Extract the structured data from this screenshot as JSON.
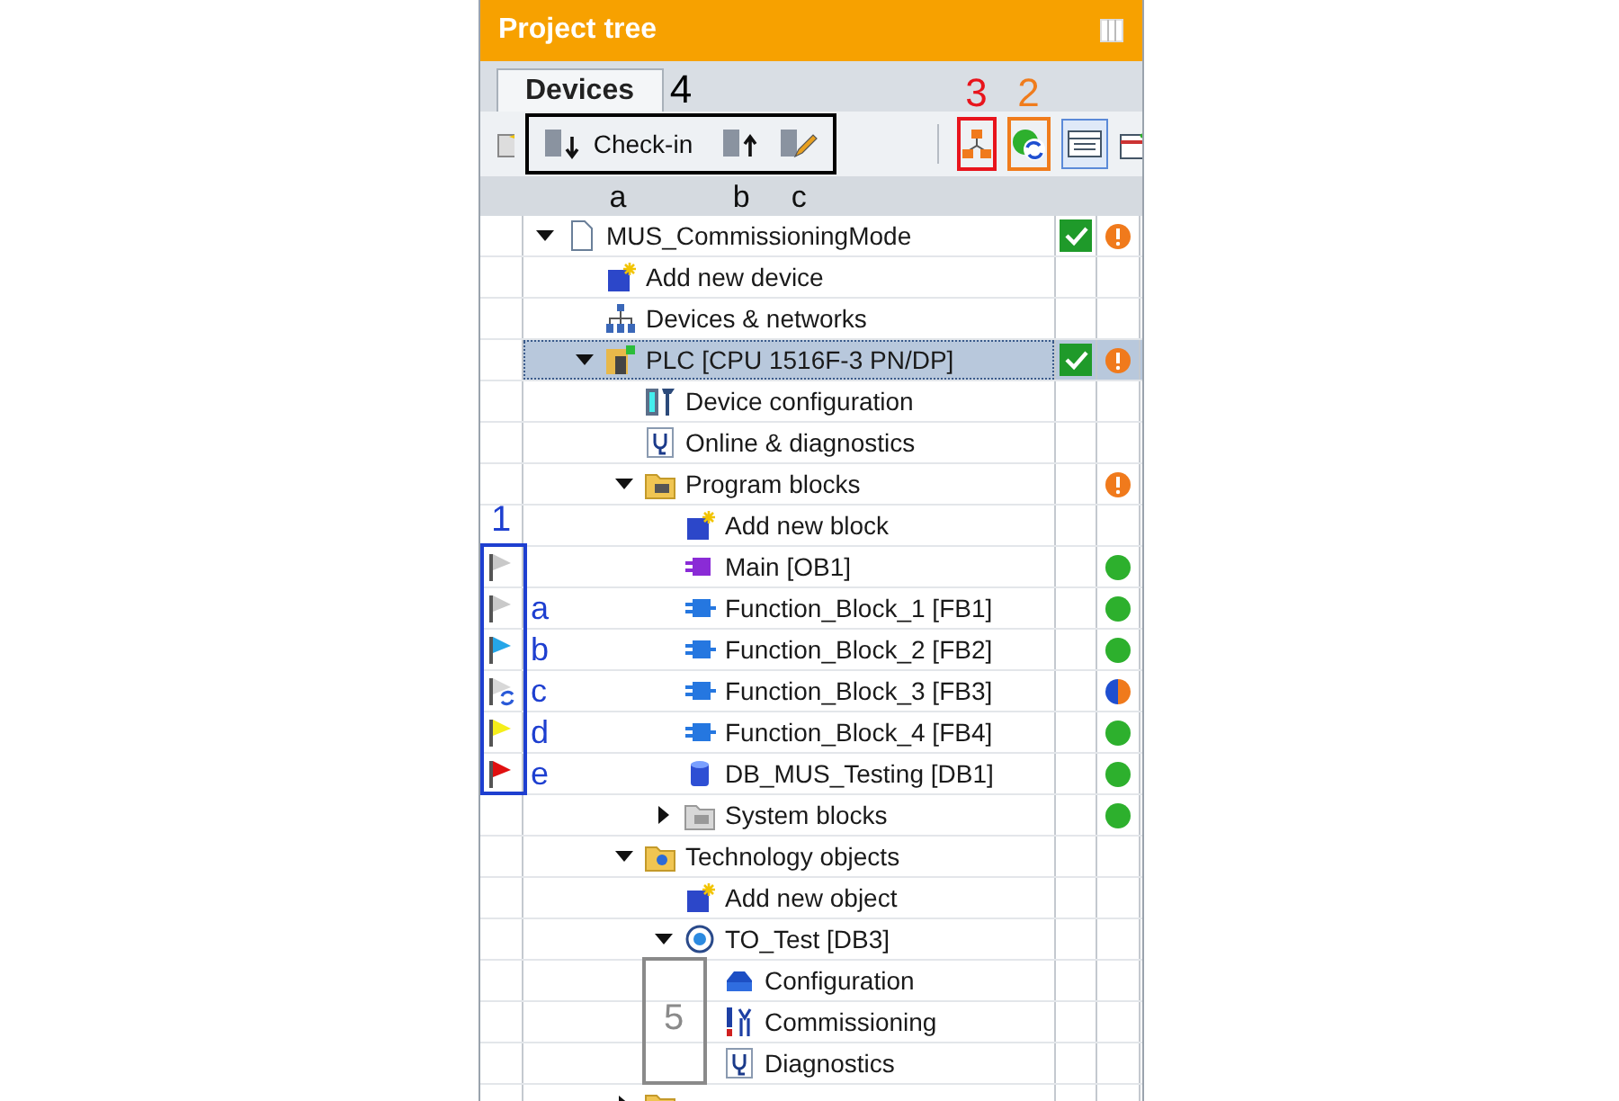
{
  "window": {
    "title": "Project tree"
  },
  "tabs": [
    {
      "label": "Devices",
      "selected": true
    }
  ],
  "toolbar": {
    "group_label": "4",
    "check_in": {
      "label": "Check-in",
      "note": "a"
    },
    "check_out_note": "b",
    "edit_note": "c",
    "hierarchy": {
      "label": "3",
      "color": "#e8141c"
    },
    "refresh": {
      "label": "2",
      "color": "#f07c1c"
    }
  },
  "flag_box": {
    "label": "1",
    "color": "#1e3fd0"
  },
  "commissioning_box": {
    "label": "5",
    "color": "#8a8a8a"
  },
  "tree": [
    {
      "label": "MUS_CommissioningMode",
      "kind": "document",
      "expanded": true,
      "check": true,
      "status": {
        "kind": "warning"
      },
      "children": [
        {
          "label": "Add new device",
          "kind": "add"
        },
        {
          "label": "Devices & networks",
          "kind": "network"
        },
        {
          "label": "PLC [CPU 1516F-3 PN/DP]",
          "kind": "plc",
          "expanded": true,
          "selected": true,
          "check": true,
          "status": {
            "kind": "warning"
          },
          "children": [
            {
              "label": "Device configuration",
              "kind": "config"
            },
            {
              "label": "Online & diagnostics",
              "kind": "diag"
            },
            {
              "label": "Program blocks",
              "kind": "folder",
              "expanded": true,
              "status": {
                "kind": "warning"
              },
              "children": [
                {
                  "label": "Add new block",
                  "kind": "add"
                },
                {
                  "label": "Main [OB1]",
                  "kind": "block_ob",
                  "flag": {
                    "color": "#c9c9c9",
                    "syncing": false
                  },
                  "status": {
                    "kind": "ok"
                  }
                },
                {
                  "label": "Function_Block_1 [FB1]",
                  "kind": "block_fb",
                  "flag": {
                    "color": "#c9c9c9",
                    "syncing": false
                  },
                  "legend": "a",
                  "status": {
                    "kind": "ok"
                  }
                },
                {
                  "label": "Function_Block_2 [FB2]",
                  "kind": "block_fb",
                  "flag": {
                    "color": "#25a6e8",
                    "syncing": false
                  },
                  "legend": "b",
                  "status": {
                    "kind": "ok"
                  }
                },
                {
                  "label": "Function_Block_3 [FB3]",
                  "kind": "block_fb",
                  "flag": {
                    "color": "#d8d8d8",
                    "syncing": true
                  },
                  "legend": "c",
                  "status": {
                    "kind": "mixed"
                  }
                },
                {
                  "label": "Function_Block_4 [FB4]",
                  "kind": "block_fb",
                  "flag": {
                    "color": "#f5ee1a",
                    "syncing": false
                  },
                  "legend": "d",
                  "status": {
                    "kind": "ok"
                  }
                },
                {
                  "label": "DB_MUS_Testing [DB1]",
                  "kind": "db",
                  "flag": {
                    "color": "#e01010",
                    "syncing": false
                  },
                  "legend": "e",
                  "status": {
                    "kind": "ok"
                  }
                },
                {
                  "label": "System blocks",
                  "kind": "folder_sys",
                  "expanded": false,
                  "status": {
                    "kind": "ok"
                  }
                }
              ]
            },
            {
              "label": "Technology objects",
              "kind": "folder_tech",
              "expanded": true,
              "children": [
                {
                  "label": "Add new object",
                  "kind": "add"
                },
                {
                  "label": "TO_Test [DB3]",
                  "kind": "to",
                  "expanded": true,
                  "children": [
                    {
                      "label": "Configuration",
                      "kind": "configuration",
                      "boxed": true
                    },
                    {
                      "label": "Commissioning",
                      "kind": "commissioning",
                      "boxed": true
                    },
                    {
                      "label": "Diagnostics",
                      "kind": "diag",
                      "boxed": true
                    }
                  ]
                }
              ]
            },
            {
              "kind": "folder",
              "expanded": false
            }
          ]
        }
      ]
    }
  ]
}
